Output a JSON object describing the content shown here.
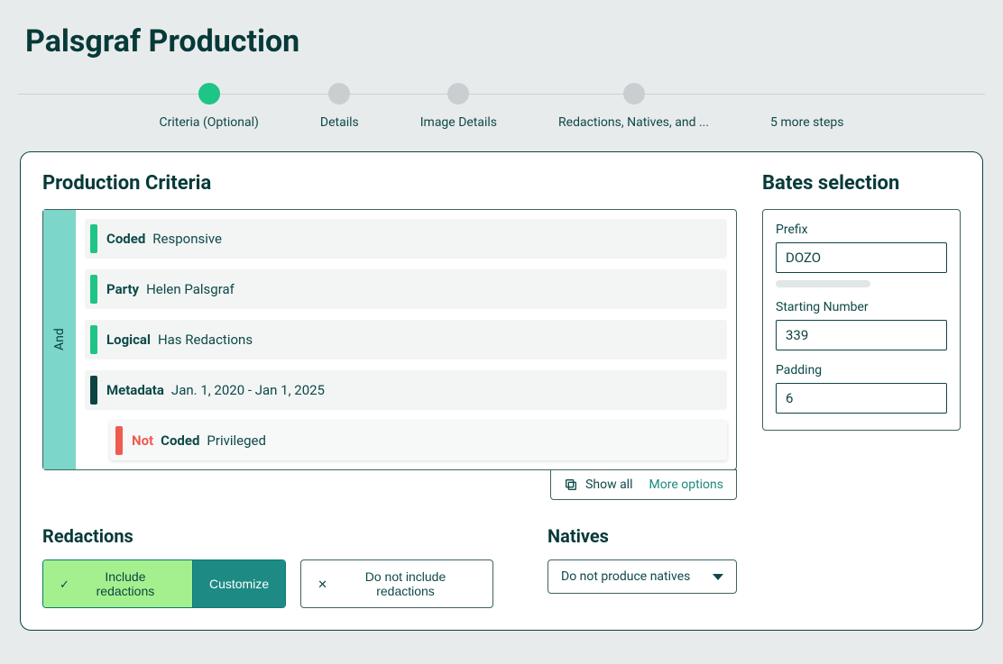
{
  "page_title": "Palsgraf Production",
  "stepper": {
    "active_index": 0,
    "steps": [
      {
        "label": "Criteria (Optional)"
      },
      {
        "label": "Details"
      },
      {
        "label": "Image Details"
      },
      {
        "label": "Redactions, Natives, and ..."
      },
      {
        "label": "5 more steps"
      }
    ]
  },
  "criteria": {
    "heading": "Production Criteria",
    "joiner": "And",
    "rows": [
      {
        "bar": "green",
        "key": "Coded",
        "value": "Responsive"
      },
      {
        "bar": "green",
        "key": "Party",
        "value": "Helen Palsgraf"
      },
      {
        "bar": "green",
        "key": "Logical",
        "value": "Has Redactions"
      },
      {
        "bar": "darkteal",
        "key": "Metadata",
        "value": "Jan. 1, 2020 - Jan 1, 2025"
      },
      {
        "bar": "red",
        "not": "Not",
        "key": "Coded",
        "value": "Privileged",
        "indented": true
      }
    ],
    "footer": {
      "show_all": "Show all",
      "more_options": "More options"
    }
  },
  "redactions": {
    "heading": "Redactions",
    "include_label": "Include redactions",
    "customize_label": "Customize",
    "exclude_label": "Do not include redactions"
  },
  "natives": {
    "heading": "Natives",
    "selected": "Do not produce natives"
  },
  "bates": {
    "heading": "Bates selection",
    "prefix_label": "Prefix",
    "prefix_value": "DOZO",
    "starting_label": "Starting Number",
    "starting_value": "339",
    "padding_label": "Padding",
    "padding_value": "6"
  }
}
